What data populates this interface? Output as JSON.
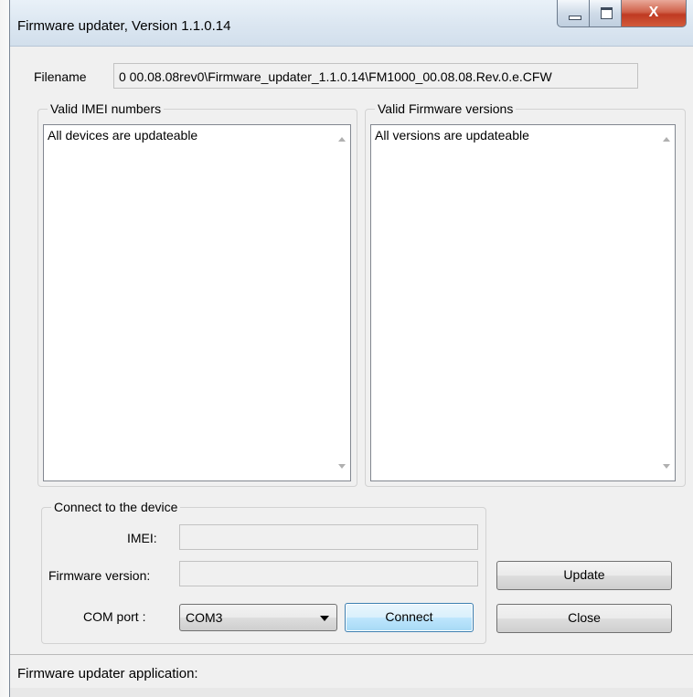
{
  "window": {
    "title": "Firmware updater, Version 1.1.0.14",
    "close_glyph": "X"
  },
  "filename": {
    "label": "Filename",
    "value": "0 00.08.08rev0\\Firmware_updater_1.1.0.14\\FM1000_00.08.08.Rev.0.e.CFW"
  },
  "imei_group": {
    "legend": "Valid IMEI numbers",
    "items": [
      "All devices are updateable"
    ]
  },
  "firmware_group": {
    "legend": "Valid Firmware versions",
    "items": [
      "All versions are updateable"
    ]
  },
  "connect_group": {
    "legend": "Connect to the device",
    "imei_label": "IMEI:",
    "imei_value": "",
    "firmware_label": "Firmware version:",
    "firmware_value": "",
    "com_label": "COM port :",
    "com_value": "COM3",
    "connect_label": "Connect"
  },
  "actions": {
    "update_label": "Update",
    "close_label": "Close"
  },
  "status": {
    "text": "Firmware updater application:"
  }
}
